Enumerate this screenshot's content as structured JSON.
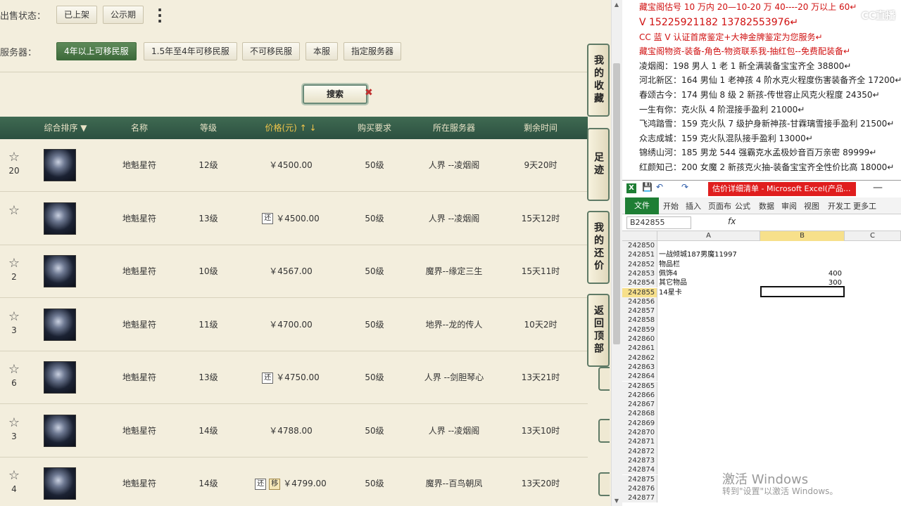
{
  "filters": {
    "sale_status_label": "出售状态：",
    "sale_status_options": [
      "已上架",
      "公示期"
    ],
    "more_label": "⋮",
    "server_label": "服务器：",
    "server_options": [
      "4年以上可移民服",
      "1.5年至4年可移民服",
      "不可移民服",
      "本服",
      "指定服务器"
    ]
  },
  "search": {
    "label": "搜索",
    "clear": "✖"
  },
  "table": {
    "headers": [
      "综合排序 ▼",
      "名称",
      "等级",
      "价格(元) ↑ ↓",
      "购买要求",
      "所在服务器",
      "剩余时间"
    ],
    "rows": [
      {
        "fav": "20",
        "name": "地魁星符",
        "level": "12级",
        "tags": [],
        "price": "￥4500.00",
        "req": "50级",
        "server": "人界 --凌烟阁",
        "time": "9天20时"
      },
      {
        "fav": "",
        "name": "地魁星符",
        "level": "13级",
        "tags": [
          "还"
        ],
        "price": "￥4500.00",
        "req": "50级",
        "server": "人界 --凌烟阁",
        "time": "15天12时"
      },
      {
        "fav": "2",
        "name": "地魁星符",
        "level": "10级",
        "tags": [],
        "price": "￥4567.00",
        "req": "50级",
        "server": "魔界--缘定三生",
        "time": "15天11时"
      },
      {
        "fav": "3",
        "name": "地魁星符",
        "level": "11级",
        "tags": [],
        "price": "￥4700.00",
        "req": "50级",
        "server": "地界--龙的传人",
        "time": "10天2时"
      },
      {
        "fav": "6",
        "name": "地魁星符",
        "level": "13级",
        "tags": [
          "还"
        ],
        "price": "￥4750.00",
        "req": "50级",
        "server": "人界 --剑胆琴心",
        "time": "13天21时"
      },
      {
        "fav": "3",
        "name": "地魁星符",
        "level": "14级",
        "tags": [],
        "price": "￥4788.00",
        "req": "50级",
        "server": "人界 --凌烟阁",
        "time": "13天10时"
      },
      {
        "fav": "4",
        "name": "地魁星符",
        "level": "14级",
        "tags": [
          "还",
          "移"
        ],
        "price": "￥4799.00",
        "req": "50级",
        "server": "魔界--百鸟朝凤",
        "time": "13天20时"
      }
    ]
  },
  "side_nav": [
    "我的收藏",
    "足迹",
    "我的还价",
    "返回顶部"
  ],
  "notes": [
    {
      "text": "藏宝阁估号 10 万内 20—10-20 万 40----20 万以上 60↵",
      "style": "red"
    },
    {
      "text": "V 15225921182   13782553976↵",
      "style": "red big"
    },
    {
      "text": "CC 蓝 V 认证首席鉴定+大神金牌鉴定为您服务↵",
      "style": "red"
    },
    {
      "text": "藏宝阁物资-装备-角色-物资联系我-抽红包--免费配装备↵",
      "style": "red"
    },
    {
      "text": "凌烟阁：198 男人 1 老 1 新全满装备宝宝齐全 38800↵",
      "style": ""
    },
    {
      "text": "河北新区：164 男仙 1 老神孩 4 阶水克火程度伤害装备齐全 17200↵",
      "style": ""
    },
    {
      "text": "春颂古今：174 男仙 8 级 2 新孩-传世容止风克火程度 24350↵",
      "style": ""
    },
    {
      "text": "一生有你：克火队 4 阶混接手盈利 21000↵",
      "style": ""
    },
    {
      "text": "飞鸿踏雪：159 克火队 7 级护身新神孩-甘霖璃雪接手盈利 21500↵",
      "style": ""
    },
    {
      "text": "众志成城：159 克火队混队接手盈利 13000↵",
      "style": ""
    },
    {
      "text": "锦绣山河：185 男龙 544 强霸克水孟极妙音百万亲密 89999↵",
      "style": ""
    },
    {
      "text": "红颜知己：200 女魔 2 新孩克火抽-装备宝宝齐全性价比高 18000↵",
      "style": ""
    }
  ],
  "overlay_watermark": "CC直播",
  "excel": {
    "title": "估价详细清单 - Microsoft Excel(产品...",
    "ribbon_tabs": [
      "文件",
      "开始",
      "插入",
      "页面布",
      "公式",
      "数据",
      "审阅",
      "视图",
      "开发工",
      "更多工"
    ],
    "name_box": "B242855",
    "fx": "fx",
    "columns": [
      "A",
      "B",
      "C"
    ],
    "rows": [
      {
        "n": "242850",
        "a": "",
        "b": ""
      },
      {
        "n": "242851",
        "a": "一战倾城187男魔11997",
        "b": ""
      },
      {
        "n": "242852",
        "a": "物品栏",
        "b": ""
      },
      {
        "n": "242853",
        "a": "佩饰4",
        "b": "400"
      },
      {
        "n": "242854",
        "a": "其它物品",
        "b": "300"
      },
      {
        "n": "242855",
        "a": "14星卡",
        "b": ""
      },
      {
        "n": "242856",
        "a": "",
        "b": ""
      },
      {
        "n": "242857",
        "a": "",
        "b": ""
      },
      {
        "n": "242858",
        "a": "",
        "b": ""
      },
      {
        "n": "242859",
        "a": "",
        "b": ""
      },
      {
        "n": "242860",
        "a": "",
        "b": ""
      },
      {
        "n": "242861",
        "a": "",
        "b": ""
      },
      {
        "n": "242862",
        "a": "",
        "b": ""
      },
      {
        "n": "242863",
        "a": "",
        "b": ""
      },
      {
        "n": "242864",
        "a": "",
        "b": ""
      },
      {
        "n": "242865",
        "a": "",
        "b": ""
      },
      {
        "n": "242866",
        "a": "",
        "b": ""
      },
      {
        "n": "242867",
        "a": "",
        "b": ""
      },
      {
        "n": "242868",
        "a": "",
        "b": ""
      },
      {
        "n": "242869",
        "a": "",
        "b": ""
      },
      {
        "n": "242870",
        "a": "",
        "b": ""
      },
      {
        "n": "242871",
        "a": "",
        "b": ""
      },
      {
        "n": "242872",
        "a": "",
        "b": ""
      },
      {
        "n": "242873",
        "a": "",
        "b": ""
      },
      {
        "n": "242874",
        "a": "",
        "b": ""
      },
      {
        "n": "242875",
        "a": "",
        "b": ""
      },
      {
        "n": "242876",
        "a": "",
        "b": ""
      },
      {
        "n": "242877",
        "a": "",
        "b": ""
      }
    ]
  },
  "windows_activation": {
    "line1": "激活 Windows",
    "line2": "转到\"设置\"以激活 Windows。"
  },
  "colors": {
    "accent_green": "#3d6a3a",
    "header_green": "#2c5040",
    "price_gold": "#f3c64a",
    "note_red": "#d01010"
  }
}
